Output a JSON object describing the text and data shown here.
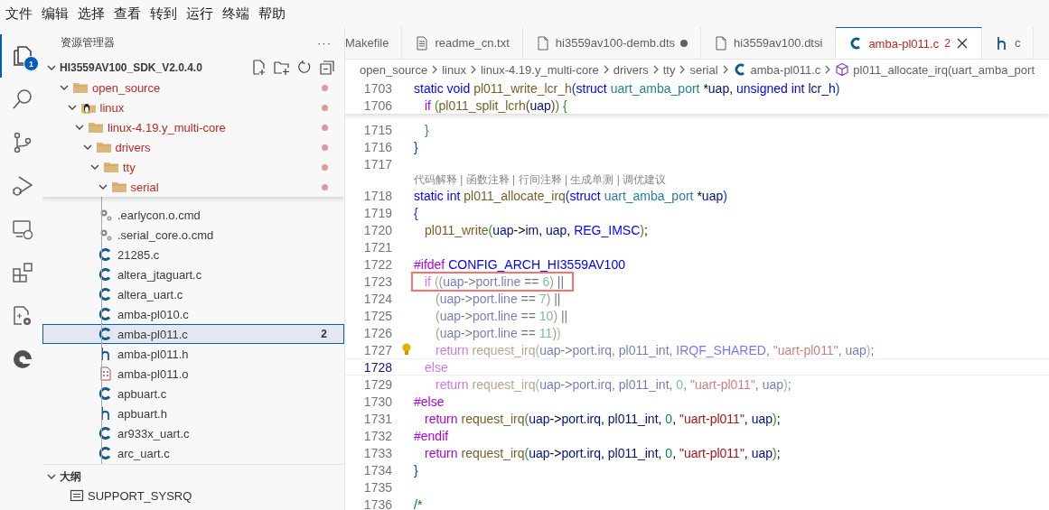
{
  "menu": [
    "文件",
    "编辑",
    "选择",
    "查看",
    "转到",
    "运行",
    "终端",
    "帮助"
  ],
  "activity": [
    {
      "kind": "explorer",
      "selected": true,
      "badge": "1"
    },
    {
      "kind": "search",
      "selected": false
    },
    {
      "kind": "scm",
      "selected": false
    },
    {
      "kind": "debug",
      "selected": false
    },
    {
      "kind": "remote",
      "selected": false
    },
    {
      "kind": "extensions",
      "selected": false
    },
    {
      "kind": "cpp",
      "selected": false
    },
    {
      "kind": "logo",
      "selected": false
    }
  ],
  "explorer": {
    "title": "资源管理器",
    "more": "···",
    "root": {
      "label": "HI3559AV100_SDK_V2.0.4.0",
      "expanded": true,
      "children": [
        {
          "label": "open_source",
          "kind": "folder",
          "expanded": true,
          "modified": true,
          "children": [
            {
              "label": "linux",
              "kind": "linux-folder",
              "expanded": true,
              "modified": true,
              "children": [
                {
                  "label": "linux-4.19.y_multi-core",
                  "kind": "folder",
                  "expanded": true,
                  "modified": true,
                  "children": [
                    {
                      "label": "drivers",
                      "kind": "folder",
                      "expanded": true,
                      "modified": true,
                      "children": [
                        {
                          "label": "tty",
                          "kind": "folder",
                          "expanded": true,
                          "modified": true,
                          "children": [
                            {
                              "label": "serial",
                              "kind": "folder",
                              "expanded": true,
                              "modified": true,
                              "children": [
                                {
                                  "label": ".earlycon.o.cmd",
                                  "kind": "cmd",
                                  "selected": false
                                },
                                {
                                  "label": ".serial_core.o.cmd",
                                  "kind": "cmd",
                                  "selected": false
                                },
                                {
                                  "label": "21285.c",
                                  "kind": "c",
                                  "selected": false
                                },
                                {
                                  "label": "altera_jtaguart.c",
                                  "kind": "c",
                                  "selected": false
                                },
                                {
                                  "label": "altera_uart.c",
                                  "kind": "c",
                                  "selected": false
                                },
                                {
                                  "label": "amba-pl010.c",
                                  "kind": "c",
                                  "selected": false
                                },
                                {
                                  "label": "amba-pl011.c",
                                  "kind": "c",
                                  "selected": true,
                                  "badge": "2"
                                },
                                {
                                  "label": "amba-pl011.h",
                                  "kind": "h",
                                  "selected": false
                                },
                                {
                                  "label": "amba-pl011.o",
                                  "kind": "obj",
                                  "selected": false
                                },
                                {
                                  "label": "apbuart.c",
                                  "kind": "c",
                                  "selected": false
                                },
                                {
                                  "label": "apbuart.h",
                                  "kind": "h",
                                  "selected": false
                                },
                                {
                                  "label": "ar933x_uart.c",
                                  "kind": "c",
                                  "selected": false
                                },
                                {
                                  "label": "arc_uart.c",
                                  "kind": "c",
                                  "selected": false
                                }
                              ]
                            }
                          ]
                        }
                      ]
                    }
                  ]
                }
              ]
            }
          ]
        }
      ]
    },
    "outline": {
      "title": "大纲",
      "expanded": true,
      "items": [
        "SUPPORT_SYSRQ"
      ]
    }
  },
  "tabs": [
    {
      "label": "Makefile",
      "kind": "none",
      "selected": false,
      "dirty": false,
      "error": false
    },
    {
      "label": "readme_cn.txt",
      "kind": "text",
      "selected": false,
      "dirty": false,
      "error": false
    },
    {
      "label": "hi3559av100-demb.dts",
      "kind": "file",
      "selected": false,
      "dirty": true,
      "error": false
    },
    {
      "label": "hi3559av100.dtsi",
      "kind": "file",
      "selected": false,
      "dirty": false,
      "error": false
    },
    {
      "label": "amba-pl011.c",
      "kind": "c",
      "selected": true,
      "dirty": false,
      "error": true,
      "badge": "2"
    },
    {
      "label": "c",
      "kind": "h",
      "selected": false,
      "dirty": false,
      "error": false
    }
  ],
  "breadcrumbs": [
    {
      "label": "open_source",
      "kind": "folder"
    },
    {
      "label": "linux",
      "kind": "folder"
    },
    {
      "label": "linux-4.19.y_multi-core",
      "kind": "folder"
    },
    {
      "label": "drivers",
      "kind": "folder"
    },
    {
      "label": "tty",
      "kind": "folder"
    },
    {
      "label": "serial",
      "kind": "folder"
    },
    {
      "label": "amba-pl011.c",
      "kind": "c"
    },
    {
      "label": "pl011_allocate_irq(uart_amba_port",
      "kind": "symbol"
    }
  ],
  "editor": {
    "sticky_lines": [
      {
        "num": "1703",
        "tokens": [
          {
            "kind": "st",
            "t": "static void "
          },
          {
            "kind": "fn",
            "t": "pl011_write_lcr_h"
          },
          {
            "kind": "b1",
            "t": "("
          },
          {
            "kind": "st",
            "t": "struct "
          },
          {
            "kind": "ty",
            "t": "uart_amba_port "
          },
          {
            "kind": "pl",
            "t": "*"
          },
          {
            "kind": "va",
            "t": "uap"
          },
          {
            "kind": "pl",
            "t": ", "
          },
          {
            "kind": "st",
            "t": "unsigned int "
          },
          {
            "kind": "va",
            "t": "lcr_h"
          },
          {
            "kind": "b1",
            "t": ")"
          }
        ]
      },
      {
        "num": "1706",
        "tokens": [
          {
            "kind": "kw",
            "t": "\tif "
          },
          {
            "kind": "b2",
            "t": "("
          },
          {
            "kind": "fn",
            "t": "pl011_split_lcrh"
          },
          {
            "kind": "b3",
            "t": "("
          },
          {
            "kind": "va",
            "t": "uap"
          },
          {
            "kind": "b3",
            "t": ")"
          },
          {
            "kind": "b2",
            "t": ") {"
          }
        ]
      }
    ],
    "lines": [
      {
        "kind": "code",
        "num": "1715",
        "dimmed": false,
        "current": false,
        "highlighted": false,
        "lightbulb": false,
        "tokens": [
          {
            "kind": "b2",
            "t": "\t}"
          }
        ]
      },
      {
        "kind": "code",
        "num": "1716",
        "dimmed": false,
        "current": false,
        "highlighted": false,
        "lightbulb": false,
        "tokens": [
          {
            "kind": "b1",
            "t": "}"
          }
        ]
      },
      {
        "kind": "code",
        "num": "1717",
        "current": false
      },
      {
        "kind": "codelens",
        "text": "代码解释 | 函数注释 | 行间注释 | 生成单测 | 调优建议"
      },
      {
        "kind": "code",
        "num": "1718",
        "dimmed": false,
        "current": false,
        "highlighted": false,
        "lightbulb": false,
        "tokens": [
          {
            "kind": "st",
            "t": "static int "
          },
          {
            "kind": "fn",
            "t": "pl011_allocate_irq"
          },
          {
            "kind": "b1",
            "t": "("
          },
          {
            "kind": "st",
            "t": "struct "
          },
          {
            "kind": "ty",
            "t": "uart_amba_port "
          },
          {
            "kind": "pl",
            "t": "*"
          },
          {
            "kind": "va",
            "t": "uap"
          },
          {
            "kind": "b1",
            "t": ")"
          }
        ]
      },
      {
        "kind": "code",
        "num": "1719",
        "dimmed": false,
        "current": false,
        "highlighted": false,
        "lightbulb": false,
        "tokens": [
          {
            "kind": "b1",
            "t": "{"
          }
        ]
      },
      {
        "kind": "code",
        "num": "1720",
        "dimmed": false,
        "current": false,
        "highlighted": false,
        "lightbulb": false,
        "tokens": [
          {
            "kind": "fn",
            "t": "\tpl011_write"
          },
          {
            "kind": "b2",
            "t": "("
          },
          {
            "kind": "va",
            "t": "uap"
          },
          {
            "kind": "pl",
            "t": "->"
          },
          {
            "kind": "va",
            "t": "im"
          },
          {
            "kind": "pl",
            "t": ", "
          },
          {
            "kind": "va",
            "t": "uap"
          },
          {
            "kind": "pl",
            "t": ", "
          },
          {
            "kind": "mc",
            "t": "REG_IMSC"
          },
          {
            "kind": "b2",
            "t": ")"
          },
          {
            "kind": "pl",
            "t": ";"
          }
        ]
      },
      {
        "kind": "code",
        "num": "1721",
        "current": false
      },
      {
        "kind": "code",
        "num": "1722",
        "dimmed": false,
        "current": false,
        "highlighted": false,
        "lightbulb": false,
        "tokens": [
          {
            "kind": "kw",
            "t": "#ifdef "
          },
          {
            "kind": "mc",
            "t": "CONFIG_ARCH_HI3559AV100"
          }
        ]
      },
      {
        "kind": "code",
        "num": "1723",
        "dimmed": true,
        "current": false,
        "highlighted": true,
        "lightbulb": false,
        "tokens": [
          {
            "kind": "kw",
            "t": "\tif "
          },
          {
            "kind": "b2",
            "t": "("
          },
          {
            "kind": "b3",
            "t": "("
          },
          {
            "kind": "va",
            "t": "uap"
          },
          {
            "kind": "pl",
            "t": "->"
          },
          {
            "kind": "va",
            "t": "port"
          },
          {
            "kind": "pl",
            "t": "."
          },
          {
            "kind": "va",
            "t": "line"
          },
          {
            "kind": "pl",
            "t": " == "
          },
          {
            "kind": "nu",
            "t": "6"
          },
          {
            "kind": "b3",
            "t": ")"
          },
          {
            "kind": "pl",
            "t": " ||"
          }
        ]
      },
      {
        "kind": "code",
        "num": "1724",
        "dimmed": true,
        "current": false,
        "highlighted": false,
        "lightbulb": false,
        "tokens": [
          {
            "kind": "b3",
            "t": "\t\t("
          },
          {
            "kind": "va",
            "t": "uap"
          },
          {
            "kind": "pl",
            "t": "->"
          },
          {
            "kind": "va",
            "t": "port"
          },
          {
            "kind": "pl",
            "t": "."
          },
          {
            "kind": "va",
            "t": "line"
          },
          {
            "kind": "pl",
            "t": " == "
          },
          {
            "kind": "nu",
            "t": "7"
          },
          {
            "kind": "b3",
            "t": ")"
          },
          {
            "kind": "pl",
            "t": " ||"
          }
        ]
      },
      {
        "kind": "code",
        "num": "1725",
        "dimmed": true,
        "current": false,
        "highlighted": false,
        "lightbulb": false,
        "tokens": [
          {
            "kind": "b3",
            "t": "\t\t("
          },
          {
            "kind": "va",
            "t": "uap"
          },
          {
            "kind": "pl",
            "t": "->"
          },
          {
            "kind": "va",
            "t": "port"
          },
          {
            "kind": "pl",
            "t": "."
          },
          {
            "kind": "va",
            "t": "line"
          },
          {
            "kind": "pl",
            "t": " == "
          },
          {
            "kind": "nu",
            "t": "10"
          },
          {
            "kind": "b3",
            "t": ")"
          },
          {
            "kind": "pl",
            "t": " ||"
          }
        ]
      },
      {
        "kind": "code",
        "num": "1726",
        "dimmed": true,
        "current": false,
        "highlighted": false,
        "lightbulb": false,
        "tokens": [
          {
            "kind": "b3",
            "t": "\t\t("
          },
          {
            "kind": "va",
            "t": "uap"
          },
          {
            "kind": "pl",
            "t": "->"
          },
          {
            "kind": "va",
            "t": "port"
          },
          {
            "kind": "pl",
            "t": "."
          },
          {
            "kind": "va",
            "t": "line"
          },
          {
            "kind": "pl",
            "t": " == "
          },
          {
            "kind": "nu",
            "t": "11"
          },
          {
            "kind": "b3",
            "t": ")"
          },
          {
            "kind": "b2",
            "t": ")"
          }
        ]
      },
      {
        "kind": "code",
        "num": "1727",
        "dimmed": true,
        "current": false,
        "highlighted": false,
        "lightbulb": true,
        "tokens": [
          {
            "kind": "kw",
            "t": "\t\treturn "
          },
          {
            "kind": "fn",
            "t": "request_irq"
          },
          {
            "kind": "b2",
            "t": "("
          },
          {
            "kind": "va",
            "t": "uap"
          },
          {
            "kind": "pl",
            "t": "->"
          },
          {
            "kind": "va",
            "t": "port"
          },
          {
            "kind": "pl",
            "t": "."
          },
          {
            "kind": "va",
            "t": "irq"
          },
          {
            "kind": "pl",
            "t": ", "
          },
          {
            "kind": "va",
            "t": "pl011_int"
          },
          {
            "kind": "pl",
            "t": ", "
          },
          {
            "kind": "mc",
            "t": "IRQF_SHARED"
          },
          {
            "kind": "pl",
            "t": ", "
          },
          {
            "kind": "s",
            "t": "\"uart-pl011\""
          },
          {
            "kind": "pl",
            "t": ", "
          },
          {
            "kind": "va",
            "t": "uap"
          },
          {
            "kind": "b2",
            "t": ")"
          },
          {
            "kind": "pl",
            "t": ";"
          }
        ]
      },
      {
        "kind": "code",
        "num": "1728",
        "dimmed": true,
        "current": true,
        "highlighted": false,
        "lightbulb": false,
        "tokens": [
          {
            "kind": "kw",
            "t": "\telse"
          }
        ]
      },
      {
        "kind": "code",
        "num": "1729",
        "dimmed": true,
        "current": false,
        "highlighted": false,
        "lightbulb": false,
        "tokens": [
          {
            "kind": "kw",
            "t": "\t\treturn "
          },
          {
            "kind": "fn",
            "t": "request_irq"
          },
          {
            "kind": "b2",
            "t": "("
          },
          {
            "kind": "va",
            "t": "uap"
          },
          {
            "kind": "pl",
            "t": "->"
          },
          {
            "kind": "va",
            "t": "port"
          },
          {
            "kind": "pl",
            "t": "."
          },
          {
            "kind": "va",
            "t": "irq"
          },
          {
            "kind": "pl",
            "t": ", "
          },
          {
            "kind": "va",
            "t": "pl011_int"
          },
          {
            "kind": "pl",
            "t": ", "
          },
          {
            "kind": "nu",
            "t": "0"
          },
          {
            "kind": "pl",
            "t": ", "
          },
          {
            "kind": "s",
            "t": "\"uart-pl011\""
          },
          {
            "kind": "pl",
            "t": ", "
          },
          {
            "kind": "va",
            "t": "uap"
          },
          {
            "kind": "b2",
            "t": ")"
          },
          {
            "kind": "pl",
            "t": ";"
          }
        ]
      },
      {
        "kind": "code",
        "num": "1730",
        "dimmed": false,
        "current": false,
        "highlighted": false,
        "lightbulb": false,
        "tokens": [
          {
            "kind": "kw",
            "t": "#else"
          }
        ]
      },
      {
        "kind": "code",
        "num": "1731",
        "dimmed": false,
        "current": false,
        "highlighted": false,
        "lightbulb": false,
        "tokens": [
          {
            "kind": "kw",
            "t": "\treturn "
          },
          {
            "kind": "fn",
            "t": "request_irq"
          },
          {
            "kind": "b2",
            "t": "("
          },
          {
            "kind": "va",
            "t": "uap"
          },
          {
            "kind": "pl",
            "t": "->"
          },
          {
            "kind": "va",
            "t": "port"
          },
          {
            "kind": "pl",
            "t": "."
          },
          {
            "kind": "va",
            "t": "irq"
          },
          {
            "kind": "pl",
            "t": ", "
          },
          {
            "kind": "va",
            "t": "pl011_int"
          },
          {
            "kind": "pl",
            "t": ", "
          },
          {
            "kind": "nu",
            "t": "0"
          },
          {
            "kind": "pl",
            "t": ", "
          },
          {
            "kind": "s",
            "t": "\"uart-pl011\""
          },
          {
            "kind": "pl",
            "t": ", "
          },
          {
            "kind": "va",
            "t": "uap"
          },
          {
            "kind": "b2",
            "t": ")"
          },
          {
            "kind": "pl",
            "t": ";"
          }
        ]
      },
      {
        "kind": "code",
        "num": "1732",
        "dimmed": false,
        "current": false,
        "highlighted": false,
        "lightbulb": false,
        "tokens": [
          {
            "kind": "kw",
            "t": "#endif"
          }
        ]
      },
      {
        "kind": "code",
        "num": "1733",
        "dimmed": false,
        "current": false,
        "highlighted": false,
        "lightbulb": false,
        "tokens": [
          {
            "kind": "kw",
            "t": "\treturn "
          },
          {
            "kind": "fn",
            "t": "request_irq"
          },
          {
            "kind": "b2",
            "t": "("
          },
          {
            "kind": "va",
            "t": "uap"
          },
          {
            "kind": "pl",
            "t": "->"
          },
          {
            "kind": "va",
            "t": "port"
          },
          {
            "kind": "pl",
            "t": "."
          },
          {
            "kind": "va",
            "t": "irq"
          },
          {
            "kind": "pl",
            "t": ", "
          },
          {
            "kind": "va",
            "t": "pl011_int"
          },
          {
            "kind": "pl",
            "t": ", "
          },
          {
            "kind": "nu",
            "t": "0"
          },
          {
            "kind": "pl",
            "t": ", "
          },
          {
            "kind": "s",
            "t": "\"uart-pl011\""
          },
          {
            "kind": "pl",
            "t": ", "
          },
          {
            "kind": "va",
            "t": "uap"
          },
          {
            "kind": "b2",
            "t": ")"
          },
          {
            "kind": "pl",
            "t": ";"
          }
        ]
      },
      {
        "kind": "code",
        "num": "1734",
        "dimmed": false,
        "current": false,
        "highlighted": false,
        "lightbulb": false,
        "tokens": [
          {
            "kind": "b1",
            "t": "}"
          }
        ]
      },
      {
        "kind": "code",
        "num": "1735",
        "current": false
      },
      {
        "kind": "code",
        "num": "1736",
        "dimmed": false,
        "current": false,
        "highlighted": false,
        "lightbulb": false,
        "tokens": [
          {
            "kind": "cm",
            "t": "/*"
          }
        ]
      }
    ]
  }
}
